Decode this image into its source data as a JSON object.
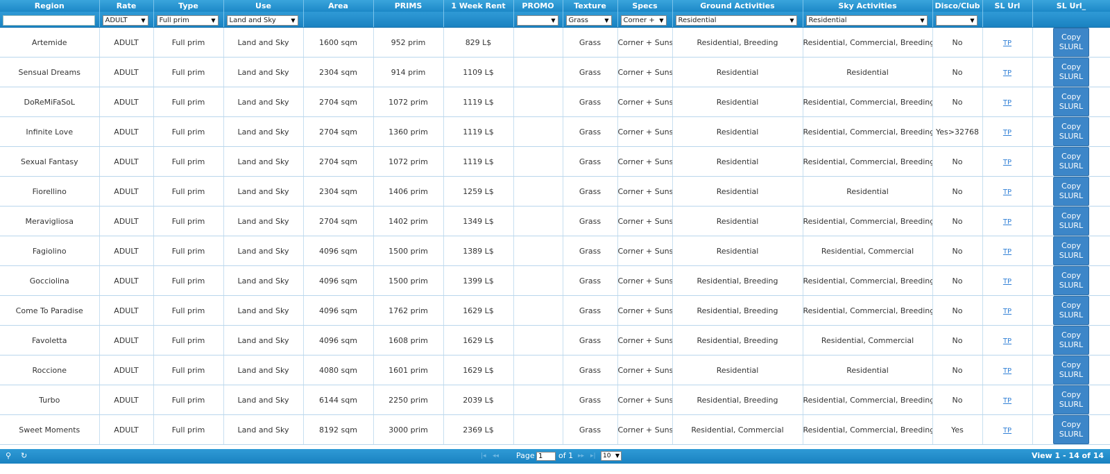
{
  "headers": [
    "Region",
    "Rate",
    "Type",
    "Use",
    "Area",
    "PRIMS",
    "1 Week Rent",
    "PROMO",
    "Texture",
    "Specs",
    "Ground Activities",
    "Sky Activities",
    "Disco/Club",
    "SL Url",
    "SL Url_"
  ],
  "filters": {
    "region_value": "",
    "rate": "ADULT",
    "type": "Full prim",
    "use": "Land and Sky",
    "promo": "",
    "texture": "Grass",
    "specs": "Corner +",
    "ground": "Residential",
    "sky": "Residential",
    "disco": ""
  },
  "rows": [
    {
      "region": "Artemide",
      "rate": "ADULT",
      "type": "Full prim",
      "use": "Land and Sky",
      "area": "1600 sqm",
      "prims": "952 prim",
      "rent": "829 L$",
      "promo": "",
      "texture": "Grass",
      "specs": "Corner + Sunse",
      "ground": "Residential, Breeding",
      "sky": "Residential, Commercial, Breeding",
      "disco": "No",
      "tp": "TP",
      "copy": "Copy SLURL"
    },
    {
      "region": "Sensual Dreams",
      "rate": "ADULT",
      "type": "Full prim",
      "use": "Land and Sky",
      "area": "2304 sqm",
      "prims": "914 prim",
      "rent": "1109 L$",
      "promo": "",
      "texture": "Grass",
      "specs": "Corner + Sunse",
      "ground": "Residential",
      "sky": "Residential",
      "disco": "No",
      "tp": "TP",
      "copy": "Copy SLURL"
    },
    {
      "region": "DoReMiFaSoL",
      "rate": "ADULT",
      "type": "Full prim",
      "use": "Land and Sky",
      "area": "2704 sqm",
      "prims": "1072 prim",
      "rent": "1119 L$",
      "promo": "",
      "texture": "Grass",
      "specs": "Corner + Sunse",
      "ground": "Residential",
      "sky": "Residential, Commercial, Breeding",
      "disco": "No",
      "tp": "TP",
      "copy": "Copy SLURL"
    },
    {
      "region": "Infinite Love",
      "rate": "ADULT",
      "type": "Full prim",
      "use": "Land and Sky",
      "area": "2704 sqm",
      "prims": "1360 prim",
      "rent": "1119 L$",
      "promo": "",
      "texture": "Grass",
      "specs": "Corner + Sunse",
      "ground": "Residential",
      "sky": "Residential, Commercial, Breeding",
      "disco": "Yes>32768",
      "tp": "TP",
      "copy": "Copy SLURL"
    },
    {
      "region": "Sexual Fantasy",
      "rate": "ADULT",
      "type": "Full prim",
      "use": "Land and Sky",
      "area": "2704 sqm",
      "prims": "1072 prim",
      "rent": "1119 L$",
      "promo": "",
      "texture": "Grass",
      "specs": "Corner + Sunse",
      "ground": "Residential",
      "sky": "Residential, Commercial, Breeding",
      "disco": "No",
      "tp": "TP",
      "copy": "Copy SLURL"
    },
    {
      "region": "Fiorellino",
      "rate": "ADULT",
      "type": "Full prim",
      "use": "Land and Sky",
      "area": "2304 sqm",
      "prims": "1406 prim",
      "rent": "1259 L$",
      "promo": "",
      "texture": "Grass",
      "specs": "Corner + Sunse",
      "ground": "Residential",
      "sky": "Residential",
      "disco": "No",
      "tp": "TP",
      "copy": "Copy SLURL"
    },
    {
      "region": "Meravigliosa",
      "rate": "ADULT",
      "type": "Full prim",
      "use": "Land and Sky",
      "area": "2704 sqm",
      "prims": "1402 prim",
      "rent": "1349 L$",
      "promo": "",
      "texture": "Grass",
      "specs": "Corner + Sunse",
      "ground": "Residential",
      "sky": "Residential, Commercial, Breeding",
      "disco": "No",
      "tp": "TP",
      "copy": "Copy SLURL"
    },
    {
      "region": "Fagiolino",
      "rate": "ADULT",
      "type": "Full prim",
      "use": "Land and Sky",
      "area": "4096 sqm",
      "prims": "1500 prim",
      "rent": "1389 L$",
      "promo": "",
      "texture": "Grass",
      "specs": "Corner + Sunse",
      "ground": "Residential",
      "sky": "Residential, Commercial",
      "disco": "No",
      "tp": "TP",
      "copy": "Copy SLURL"
    },
    {
      "region": "Gocciolina",
      "rate": "ADULT",
      "type": "Full prim",
      "use": "Land and Sky",
      "area": "4096 sqm",
      "prims": "1500 prim",
      "rent": "1399 L$",
      "promo": "",
      "texture": "Grass",
      "specs": "Corner + Sunse",
      "ground": "Residential, Breeding",
      "sky": "Residential, Commercial, Breeding",
      "disco": "No",
      "tp": "TP",
      "copy": "Copy SLURL"
    },
    {
      "region": "Come To Paradise",
      "rate": "ADULT",
      "type": "Full prim",
      "use": "Land and Sky",
      "area": "4096 sqm",
      "prims": "1762 prim",
      "rent": "1629 L$",
      "promo": "",
      "texture": "Grass",
      "specs": "Corner + Sunse",
      "ground": "Residential, Breeding",
      "sky": "Residential, Commercial, Breeding",
      "disco": "No",
      "tp": "TP",
      "copy": "Copy SLURL"
    },
    {
      "region": "Favoletta",
      "rate": "ADULT",
      "type": "Full prim",
      "use": "Land and Sky",
      "area": "4096 sqm",
      "prims": "1608 prim",
      "rent": "1629 L$",
      "promo": "",
      "texture": "Grass",
      "specs": "Corner + Sunse",
      "ground": "Residential, Breeding",
      "sky": "Residential, Commercial",
      "disco": "No",
      "tp": "TP",
      "copy": "Copy SLURL"
    },
    {
      "region": "Roccione",
      "rate": "ADULT",
      "type": "Full prim",
      "use": "Land and Sky",
      "area": "4080 sqm",
      "prims": "1601 prim",
      "rent": "1629 L$",
      "promo": "",
      "texture": "Grass",
      "specs": "Corner + Sunse",
      "ground": "Residential",
      "sky": "Residential",
      "disco": "No",
      "tp": "TP",
      "copy": "Copy SLURL"
    },
    {
      "region": "Turbo",
      "rate": "ADULT",
      "type": "Full prim",
      "use": "Land and Sky",
      "area": "6144 sqm",
      "prims": "2250 prim",
      "rent": "2039 L$",
      "promo": "",
      "texture": "Grass",
      "specs": "Corner + Sunse",
      "ground": "Residential, Breeding",
      "sky": "Residential, Commercial, Breeding",
      "disco": "No",
      "tp": "TP",
      "copy": "Copy SLURL"
    },
    {
      "region": "Sweet Moments",
      "rate": "ADULT",
      "type": "Full prim",
      "use": "Land and Sky",
      "area": "8192 sqm",
      "prims": "3000 prim",
      "rent": "2369 L$",
      "promo": "",
      "texture": "Grass",
      "specs": "Corner + Sunse",
      "ground": "Residential, Commercial",
      "sky": "Residential, Commercial, Breeding",
      "disco": "Yes",
      "tp": "TP",
      "copy": "Copy SLURL"
    }
  ],
  "pager": {
    "search_icon": "⚲",
    "refresh_icon": "↻",
    "first_icon": "|◂",
    "prev_icon": "◂◂",
    "next_icon": "▸▸",
    "last_icon": "▸|",
    "page_label": "Page",
    "page_value": "1",
    "of_label": "of 1",
    "rows_per_page": "10",
    "view_text": "View 1 - 14 of 14"
  }
}
